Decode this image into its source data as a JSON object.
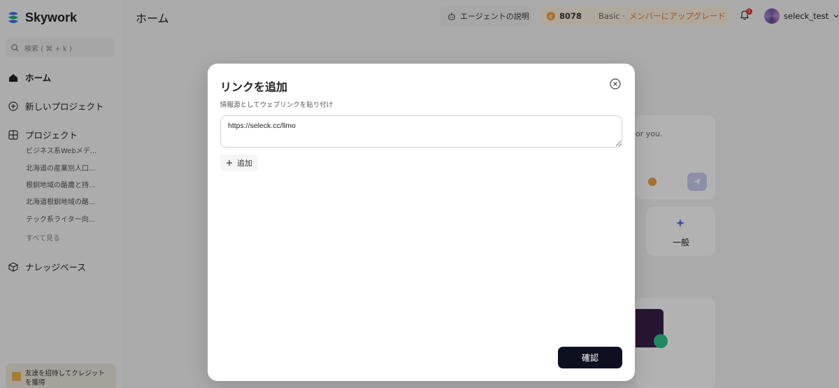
{
  "app": {
    "name": "Skywork"
  },
  "sidebar": {
    "search_placeholder": "検索 ( ⌘ + k )",
    "home": "ホーム",
    "new_project": "新しいプロジェクト",
    "projects": "プロジェクト",
    "project_items": [
      "ビジネス系Webメデ...",
      "北海道の産業別人口...",
      "根釧地域の酪農と持...",
      "北海道根釧地域の酪...",
      "テック系ライター向..."
    ],
    "see_all": "すべて見る",
    "knowledge_base": "ナレッジベース",
    "invite_text": "友達を招待してクレジットを獲得"
  },
  "header": {
    "title": "ホーム",
    "agent_button": "エージェントの説明",
    "credits": "8078",
    "plan": "Basic ·",
    "upgrade": "メンバーにアップグレード",
    "notification_count": "1",
    "username": "seleck_test"
  },
  "background": {
    "hint_text": "or you.",
    "general_label": "一般"
  },
  "modal": {
    "title": "リンクを追加",
    "subtitle": "情報源としてウェブリンクを貼り付け",
    "input_value": "https://seleck.cc/llmo",
    "add_label": "追加",
    "confirm_label": "確認"
  },
  "colors": {
    "accent": "#0d1021",
    "upgrade": "#e07a2a",
    "coin": "#f2a23c",
    "badge": "#e53935"
  }
}
